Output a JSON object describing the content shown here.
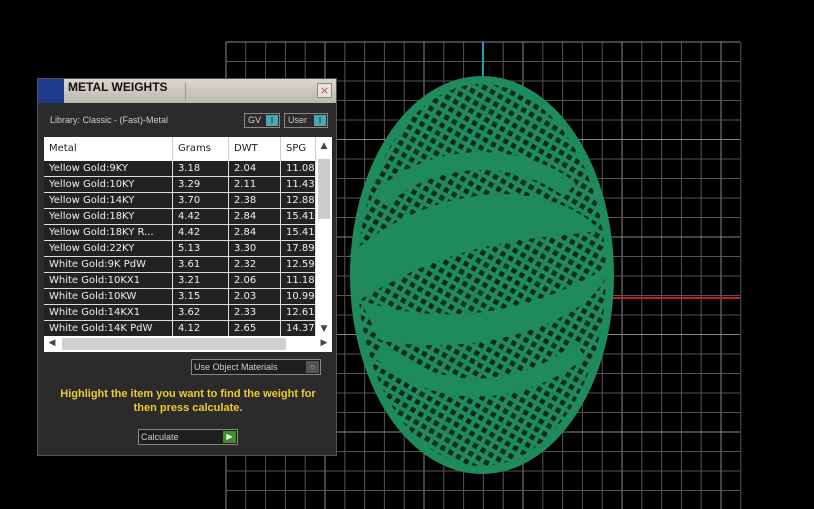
{
  "panel": {
    "title": "METAL WEIGHTS",
    "close_glyph": "×",
    "library": "Library: Classic - (Fast)-Metal",
    "toggles": [
      {
        "label": "GV",
        "state": "I"
      },
      {
        "label": "User",
        "state": "I"
      }
    ],
    "columns": [
      "Metal",
      "Grams",
      "DWT",
      "SPG"
    ],
    "rows": [
      [
        "Yellow Gold:9KY",
        "3.18",
        "2.04",
        "11.08"
      ],
      [
        "Yellow Gold:10KY",
        "3.29",
        "2.11",
        "11.43"
      ],
      [
        "Yellow Gold:14KY",
        "3.70",
        "2.38",
        "12.88"
      ],
      [
        "Yellow Gold:18KY",
        "4.42",
        "2.84",
        "15.41"
      ],
      [
        "Yellow Gold:18KY R...",
        "4.42",
        "2.84",
        "15.41"
      ],
      [
        "Yellow Gold:22KY",
        "5.13",
        "3.30",
        "17.89"
      ],
      [
        "White Gold:9K PdW",
        "3.61",
        "2.32",
        "12.59"
      ],
      [
        "White Gold:10KX1",
        "3.21",
        "2.06",
        "11.18"
      ],
      [
        "White Gold:10KW",
        "3.15",
        "2.03",
        "10.99"
      ],
      [
        "White Gold:14KX1",
        "3.62",
        "2.33",
        "12.61"
      ],
      [
        "White Gold:14K PdW",
        "4.12",
        "2.65",
        "14.37"
      ]
    ],
    "use_object_materials": "Use Object Materials",
    "hint": "Highlight the item you want to find the weight for then press calculate.",
    "calculate": "Calculate"
  }
}
